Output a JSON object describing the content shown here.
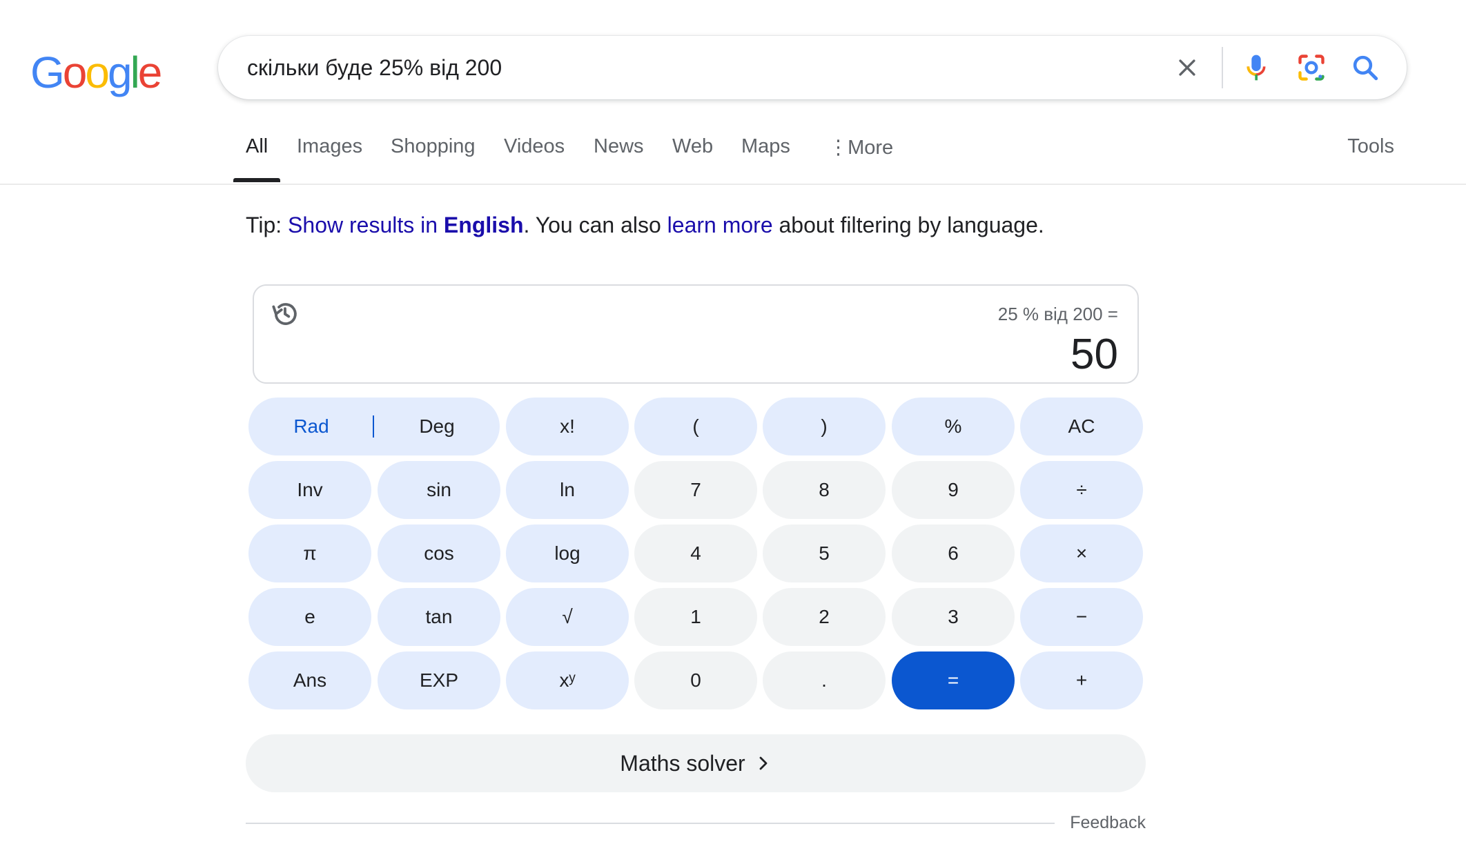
{
  "logo": {
    "letters": [
      "G",
      "o",
      "o",
      "g",
      "l",
      "e"
    ],
    "colors": [
      "#4285F4",
      "#EA4335",
      "#FBBC05",
      "#4285F4",
      "#34A853",
      "#EA4335"
    ]
  },
  "search": {
    "query": "скільки буде 25% від 200",
    "clear_icon": "close-icon",
    "voice_icon": "mic-icon",
    "lens_icon": "lens-icon",
    "search_icon": "search-icon"
  },
  "tabs": [
    {
      "label": "All",
      "active": true
    },
    {
      "label": "Images"
    },
    {
      "label": "Shopping"
    },
    {
      "label": "Videos"
    },
    {
      "label": "News"
    },
    {
      "label": "Web"
    },
    {
      "label": "Maps"
    },
    {
      "label": "More"
    }
  ],
  "tools_label": "Tools",
  "tip": {
    "prefix": "Tip: ",
    "link1_pre": "Show results in ",
    "link1_bold": "English",
    "mid": ". You can also ",
    "link2": "learn more",
    "suffix": " about filtering by language."
  },
  "calculator": {
    "expression": "25 % від 200 =",
    "result": "50",
    "rad_label": "Rad",
    "deg_label": "Deg",
    "keys": [
      [
        "x!",
        "(",
        ")",
        "%",
        "AC"
      ],
      [
        "Inv",
        "sin",
        "ln",
        "7",
        "8",
        "9",
        "÷"
      ],
      [
        "π",
        "cos",
        "log",
        "4",
        "5",
        "6",
        "×"
      ],
      [
        "e",
        "tan",
        "√",
        "1",
        "2",
        "3",
        "−"
      ],
      [
        "Ans",
        "EXP",
        "xʸ",
        "0",
        ".",
        "=",
        "+"
      ]
    ]
  },
  "solver_label": "Maths solver",
  "feedback_label": "Feedback",
  "colors": {
    "accent_blue": "#0b57d0",
    "link": "#1a0dab",
    "fn_key_bg": "#e3ecfd",
    "num_key_bg": "#f1f3f4"
  }
}
